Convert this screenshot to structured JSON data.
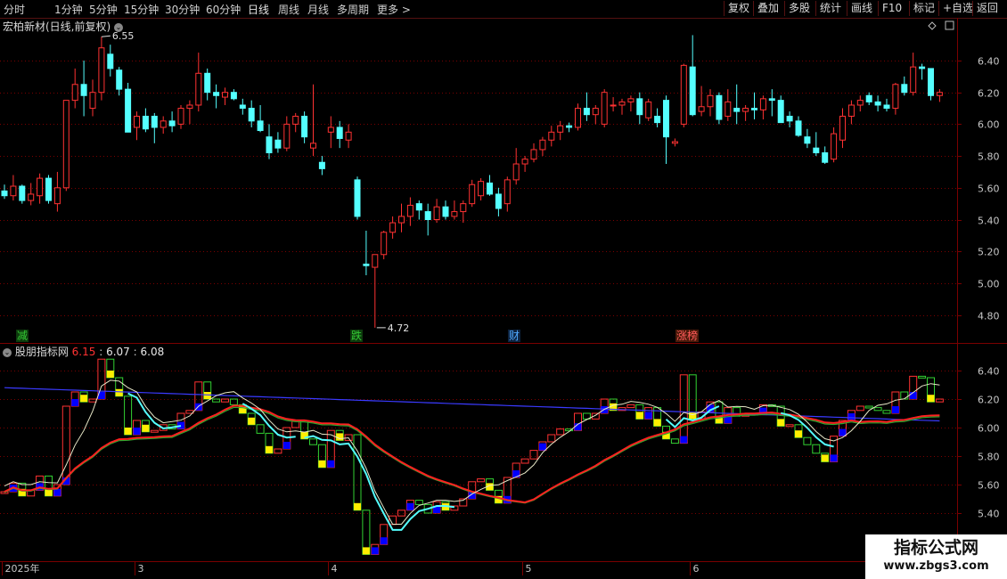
{
  "toolbar": {
    "periods": [
      "分时",
      "1分钟",
      "5分钟",
      "15分钟",
      "30分钟",
      "60分钟",
      "日线",
      "周线",
      "月线",
      "多周期",
      "更多 >"
    ],
    "active_period": "日线",
    "right_buttons": [
      "复权",
      "叠加",
      "多股",
      "统计",
      "画线",
      "F10",
      "标记",
      "+自选",
      "返回"
    ]
  },
  "main_panel": {
    "title": "宏柏新材(日线,前复权)",
    "high_label": "6.55",
    "low_label": "4.72",
    "price_axis": [
      "6.40",
      "6.20",
      "6.00",
      "5.80",
      "5.60",
      "5.40",
      "5.20",
      "5.00",
      "4.80"
    ],
    "events": [
      {
        "text": "减",
        "color": "#34c934",
        "bg": "#0d3b0d"
      },
      {
        "text": "跌",
        "color": "#34c934",
        "bg": "#0d3b0d"
      },
      {
        "text": "财",
        "color": "#4fa8ff",
        "bg": "#0d2340"
      },
      {
        "text": "涨榜",
        "color": "#ff5a5a",
        "bg": "#4a1a0a"
      }
    ]
  },
  "indicator_panel": {
    "name": "股朋指标网",
    "values": [
      "6.15",
      "6.07",
      "6.08"
    ],
    "axis": [
      "6.40",
      "6.20",
      "6.00",
      "5.80",
      "5.60",
      "5.40"
    ]
  },
  "date_axis": [
    "2025年",
    "3",
    "4",
    "5",
    "6"
  ],
  "watermark": {
    "title": "指标公式网",
    "url": "www.zbgs3.com"
  },
  "colors": {
    "up": "#ff3232",
    "down": "#54ffff",
    "bg": "#000000",
    "grid": "#7a0000",
    "axis_text": "#c8c8c8"
  },
  "chart_data": {
    "type": "candlestick",
    "ylim": [
      4.65,
      6.62
    ],
    "candles": [
      [
        5.58,
        5.62,
        5.53,
        5.55
      ],
      [
        5.55,
        5.68,
        5.52,
        5.61
      ],
      [
        5.61,
        5.62,
        5.5,
        5.52
      ],
      [
        5.52,
        5.63,
        5.49,
        5.56
      ],
      [
        5.55,
        5.69,
        5.5,
        5.66
      ],
      [
        5.66,
        5.68,
        5.5,
        5.52
      ],
      [
        5.5,
        5.7,
        5.45,
        5.6
      ],
      [
        5.6,
        6.15,
        5.58,
        6.15
      ],
      [
        6.15,
        6.35,
        6.1,
        6.25
      ],
      [
        6.25,
        6.4,
        6.05,
        6.18
      ],
      [
        6.1,
        6.28,
        6.05,
        6.2
      ],
      [
        6.2,
        6.55,
        6.15,
        6.48
      ],
      [
        6.44,
        6.5,
        6.3,
        6.35
      ],
      [
        6.34,
        6.36,
        6.18,
        6.22
      ],
      [
        6.22,
        6.26,
        6.05,
        5.95
      ],
      [
        5.98,
        6.08,
        5.9,
        6.05
      ],
      [
        6.05,
        6.1,
        5.95,
        5.97
      ],
      [
        6.05,
        6.07,
        5.88,
        5.98
      ],
      [
        5.98,
        6.05,
        5.94,
        6.02
      ],
      [
        6.02,
        6.08,
        5.95,
        5.99
      ],
      [
        6.0,
        6.12,
        5.97,
        6.1
      ],
      [
        6.1,
        6.15,
        6.0,
        6.12
      ],
      [
        6.12,
        6.45,
        6.08,
        6.32
      ],
      [
        6.32,
        6.35,
        6.15,
        6.2
      ],
      [
        6.2,
        6.25,
        6.1,
        6.18
      ],
      [
        6.17,
        6.23,
        6.12,
        6.2
      ],
      [
        6.2,
        6.22,
        6.15,
        6.16
      ],
      [
        6.12,
        6.16,
        6.06,
        6.1
      ],
      [
        6.1,
        6.15,
        5.98,
        6.02
      ],
      [
        6.02,
        6.12,
        5.95,
        5.96
      ],
      [
        5.92,
        6.0,
        5.78,
        5.82
      ],
      [
        5.9,
        5.95,
        5.82,
        5.85
      ],
      [
        5.85,
        6.05,
        5.83,
        6.0
      ],
      [
        6.0,
        6.07,
        5.95,
        6.05
      ],
      [
        6.05,
        6.08,
        5.88,
        5.92
      ],
      [
        5.85,
        6.25,
        5.8,
        5.88
      ],
      [
        5.76,
        5.8,
        5.68,
        5.72
      ],
      [
        5.95,
        6.05,
        5.85,
        5.98
      ],
      [
        5.98,
        6.02,
        5.85,
        5.91
      ],
      [
        5.9,
        6.0,
        5.85,
        5.95
      ],
      [
        5.65,
        5.67,
        5.4,
        5.42
      ],
      [
        5.12,
        5.33,
        5.05,
        5.11
      ],
      [
        5.1,
        5.18,
        4.72,
        5.18
      ],
      [
        5.18,
        5.33,
        5.15,
        5.32
      ],
      [
        5.32,
        5.42,
        5.28,
        5.38
      ],
      [
        5.38,
        5.5,
        5.32,
        5.42
      ],
      [
        5.42,
        5.54,
        5.36,
        5.49
      ],
      [
        5.5,
        5.52,
        5.4,
        5.46
      ],
      [
        5.45,
        5.5,
        5.3,
        5.4
      ],
      [
        5.4,
        5.53,
        5.38,
        5.48
      ],
      [
        5.48,
        5.52,
        5.4,
        5.42
      ],
      [
        5.42,
        5.52,
        5.4,
        5.45
      ],
      [
        5.45,
        5.52,
        5.38,
        5.5
      ],
      [
        5.5,
        5.65,
        5.48,
        5.62
      ],
      [
        5.55,
        5.66,
        5.52,
        5.64
      ],
      [
        5.63,
        5.68,
        5.55,
        5.56
      ],
      [
        5.56,
        5.6,
        5.42,
        5.47
      ],
      [
        5.5,
        5.67,
        5.45,
        5.65
      ],
      [
        5.65,
        5.85,
        5.62,
        5.75
      ],
      [
        5.75,
        5.8,
        5.7,
        5.78
      ],
      [
        5.78,
        5.88,
        5.76,
        5.84
      ],
      [
        5.84,
        5.92,
        5.8,
        5.9
      ],
      [
        5.9,
        5.99,
        5.86,
        5.95
      ],
      [
        5.95,
        6.02,
        5.9,
        5.99
      ],
      [
        5.99,
        6.01,
        5.95,
        5.98
      ],
      [
        5.98,
        6.13,
        5.96,
        6.1
      ],
      [
        6.1,
        6.2,
        6.02,
        6.06
      ],
      [
        6.06,
        6.12,
        6.0,
        6.1
      ],
      [
        6.0,
        6.22,
        5.98,
        6.2
      ],
      [
        6.12,
        6.17,
        6.08,
        6.12
      ],
      [
        6.12,
        6.16,
        6.06,
        6.14
      ],
      [
        6.14,
        6.18,
        6.08,
        6.16
      ],
      [
        6.16,
        6.2,
        6.0,
        6.06
      ],
      [
        6.04,
        6.16,
        6.02,
        6.14
      ],
      [
        6.05,
        6.1,
        5.98,
        6.01
      ],
      [
        6.15,
        6.18,
        5.75,
        5.92
      ],
      [
        5.88,
        5.91,
        5.86,
        5.89
      ],
      [
        6.0,
        6.38,
        5.98,
        6.37
      ],
      [
        6.36,
        6.56,
        6.05,
        6.06
      ],
      [
        6.08,
        6.24,
        6.05,
        6.11
      ],
      [
        6.11,
        6.22,
        6.05,
        6.18
      ],
      [
        6.18,
        6.2,
        6.0,
        6.03
      ],
      [
        6.05,
        6.22,
        6.02,
        6.14
      ],
      [
        6.1,
        6.25,
        6.0,
        6.08
      ],
      [
        6.08,
        6.12,
        6.02,
        6.1
      ],
      [
        6.1,
        6.2,
        6.03,
        6.09
      ],
      [
        6.09,
        6.18,
        6.03,
        6.16
      ],
      [
        6.16,
        6.22,
        6.05,
        6.15
      ],
      [
        6.15,
        6.18,
        6.02,
        6.01
      ],
      [
        6.05,
        6.08,
        5.98,
        6.02
      ],
      [
        6.02,
        6.05,
        5.92,
        5.93
      ],
      [
        5.92,
        5.97,
        5.85,
        5.88
      ],
      [
        5.85,
        5.95,
        5.8,
        5.82
      ],
      [
        5.82,
        5.86,
        5.75,
        5.76
      ],
      [
        5.78,
        5.98,
        5.76,
        5.94
      ],
      [
        5.9,
        6.1,
        5.85,
        6.05
      ],
      [
        6.05,
        6.15,
        6.0,
        6.12
      ],
      [
        6.12,
        6.18,
        6.08,
        6.15
      ],
      [
        6.18,
        6.2,
        6.12,
        6.14
      ],
      [
        6.14,
        6.18,
        6.08,
        6.12
      ],
      [
        6.12,
        6.16,
        6.08,
        6.1
      ],
      [
        6.1,
        6.26,
        6.06,
        6.25
      ],
      [
        6.25,
        6.3,
        6.18,
        6.2
      ],
      [
        6.2,
        6.45,
        6.18,
        6.36
      ],
      [
        6.36,
        6.38,
        6.28,
        6.35
      ],
      [
        6.35,
        6.3,
        6.15,
        6.18
      ],
      [
        6.18,
        6.22,
        6.14,
        6.2
      ]
    ]
  }
}
